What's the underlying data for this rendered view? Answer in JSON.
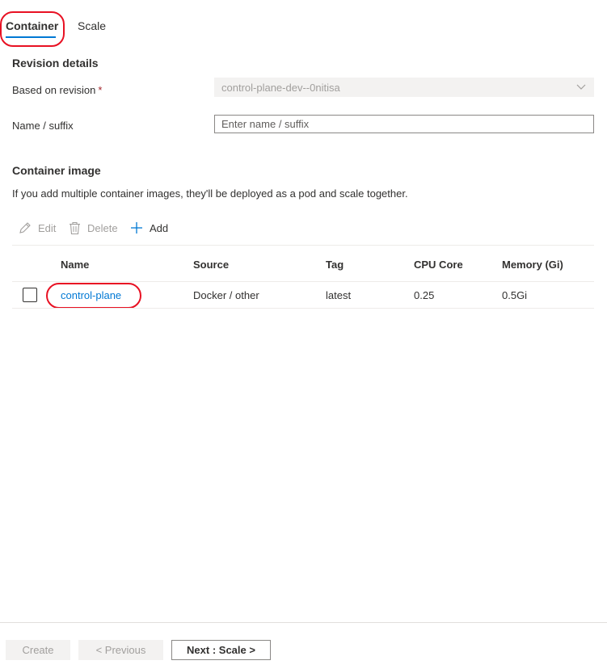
{
  "tabs": [
    {
      "label": "Container",
      "selected": true
    },
    {
      "label": "Scale",
      "selected": false
    }
  ],
  "revision_details": {
    "title": "Revision details",
    "based_on_label": "Based on revision",
    "based_on_value": "control-plane-dev--0nitisa",
    "name_label": "Name / suffix",
    "name_placeholder": "Enter name / suffix"
  },
  "container_image": {
    "title": "Container image",
    "description": "If you add multiple container images, they'll be deployed as a pod and scale together."
  },
  "toolbar": {
    "edit": "Edit",
    "delete": "Delete",
    "add": "Add"
  },
  "table": {
    "columns": [
      "Name",
      "Source",
      "Tag",
      "CPU Core",
      "Memory (Gi)"
    ],
    "rows": [
      {
        "name": "control-plane",
        "source": "Docker / other",
        "tag": "latest",
        "cpu": "0.25",
        "memory": "0.5Gi"
      }
    ]
  },
  "footer": {
    "create": "Create",
    "previous": "< Previous",
    "next": "Next : Scale >"
  },
  "colors": {
    "accent": "#0078d4",
    "annotation": "#e81123"
  }
}
